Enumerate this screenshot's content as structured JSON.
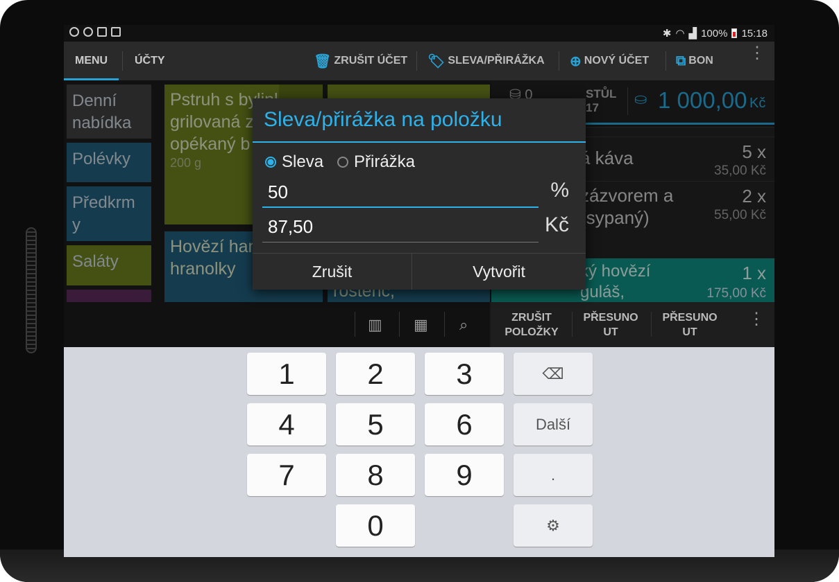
{
  "status": {
    "battery": "100%",
    "time": "15:18"
  },
  "tabs": [
    {
      "label": "MENU"
    },
    {
      "label": "ÚČTY"
    }
  ],
  "actions": {
    "cancel_account": "ZRUŠIT ÚČET",
    "discount": "SLEVA/PŘIRÁŽKA",
    "new_account": "NOVÝ ÚČET",
    "receipt": "BON"
  },
  "categories": [
    "Denní nabídka",
    "Polévky",
    "Předkrm y",
    "Saláty"
  ],
  "tiles": {
    "t1": {
      "name": "Pstruh s bylinkami, grilovaná zelenina, opékaný b",
      "sub": "200 g"
    },
    "t2": {
      "name": "Hovězí hamburger hranolky"
    },
    "t3": {
      "name": "rostenc,"
    }
  },
  "order": {
    "guests": "0",
    "table_label": "STŮL",
    "table_no": "17",
    "total": "1 000,00",
    "currency": "Kč",
    "items": [
      {
        "name": "á káva",
        "qty": "5 x",
        "price": "35,00 Kč"
      },
      {
        "name": "zázvorem a (sypaný)",
        "qty": "2 x",
        "price": "55,00 Kč"
      },
      {
        "name": "ký hovězí guláš, houskový kn…",
        "qty": "1 x",
        "price": "175,00 Kč"
      }
    ]
  },
  "bottom_buttons": {
    "cancel_items": "ZRUŠIT POLOŽKY",
    "move1": "PŘESUNO UT",
    "move2": "PŘESUNO UT"
  },
  "dialog": {
    "title": "Sleva/přirážka na položku",
    "opt_discount": "Sleva",
    "opt_surcharge": "Přirážka",
    "percent_value": "50",
    "percent_unit": "%",
    "amount_value": "87,50",
    "amount_unit": "Kč",
    "cancel": "Zrušit",
    "create": "Vytvořit"
  },
  "keyboard": {
    "k1": "1",
    "k2": "2",
    "k3": "3",
    "k4": "4",
    "k5": "5",
    "k6": "6",
    "k7": "7",
    "k8": "8",
    "k9": "9",
    "k0": "0",
    "next": "Další",
    "dot": "."
  },
  "colors": {
    "accent": "#2eb2ea",
    "tile_green": "#6b7b1e",
    "tile_blue": "#1f5c78",
    "selected_row": "#0f8a7e"
  }
}
